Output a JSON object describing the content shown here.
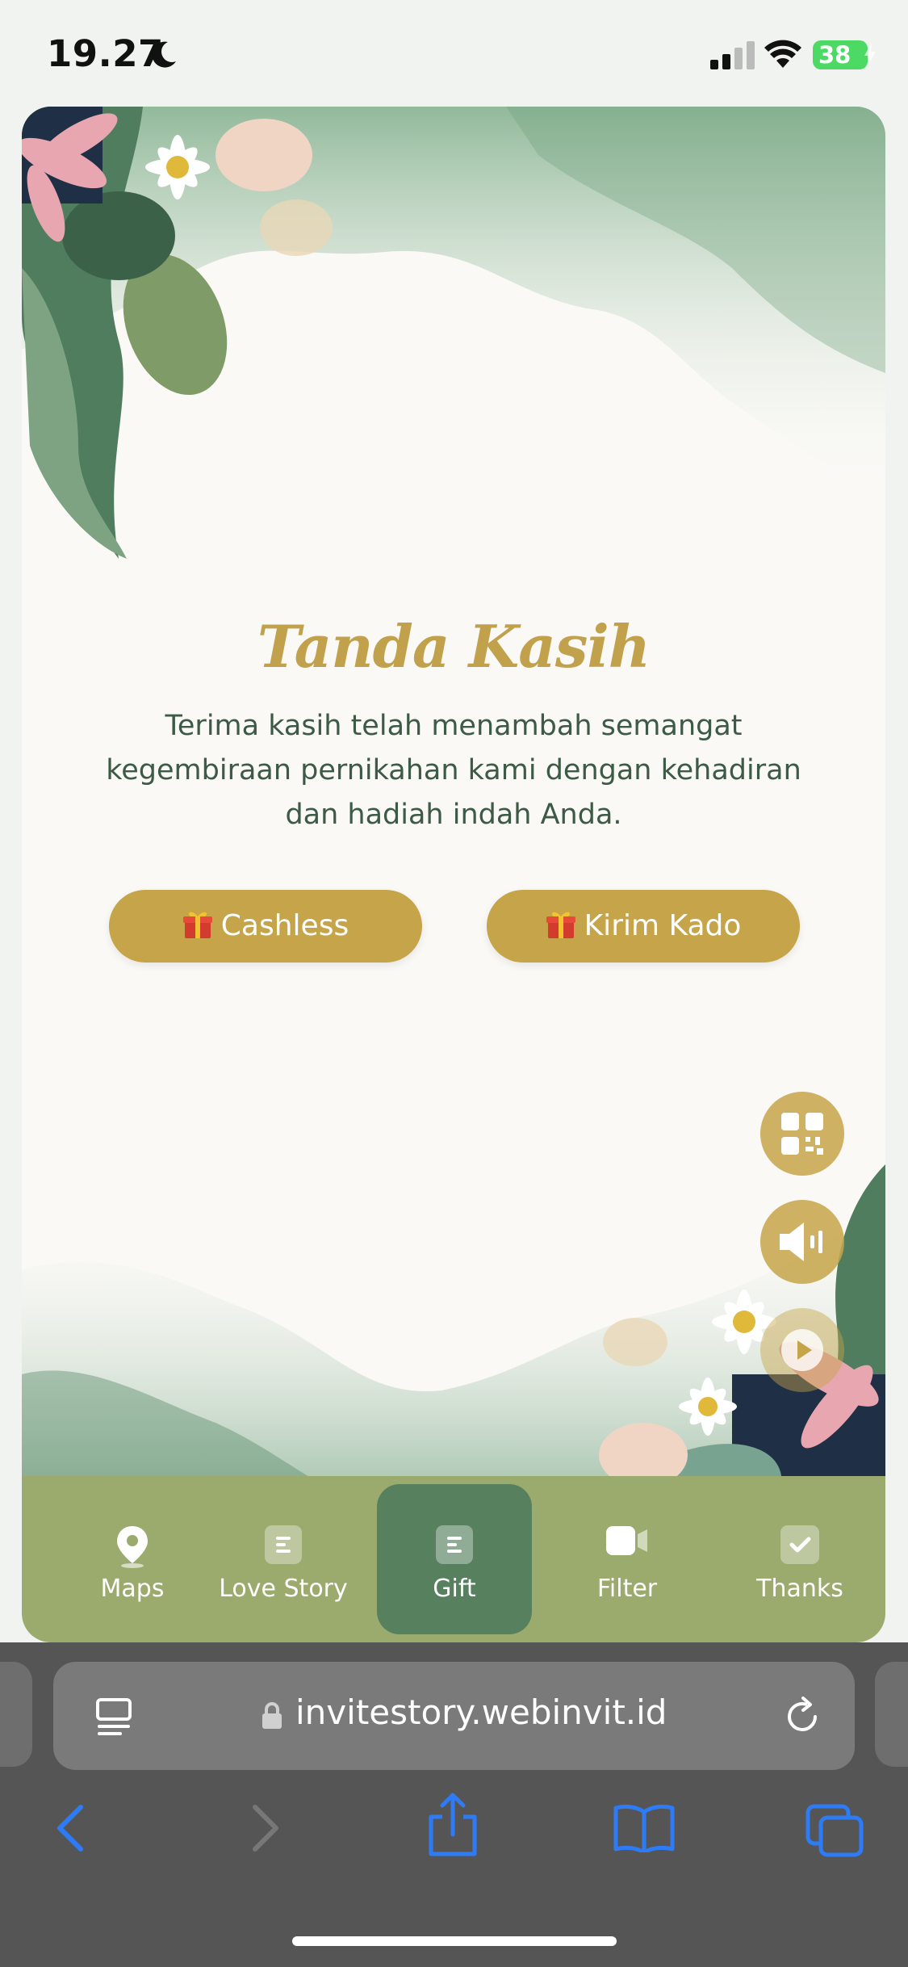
{
  "status_bar": {
    "time": "19.27",
    "battery": "38"
  },
  "gift_section": {
    "title": "Tanda Kasih",
    "message": "Terima kasih telah menambah semangat kegembiraan pernikahan kami dengan kehadiran dan hadiah indah Anda.",
    "buttons": [
      {
        "label": "Cashless",
        "icon": "gift-icon"
      },
      {
        "label": "Kirim Kado",
        "icon": "gift-icon"
      }
    ]
  },
  "floating_buttons": [
    "qr-code-icon",
    "speaker-icon",
    "play-icon"
  ],
  "nav": {
    "active": "Gift",
    "items": [
      {
        "label": "Maps",
        "icon": "map-pin-icon"
      },
      {
        "label": "Love Story",
        "icon": "document-icon"
      },
      {
        "label": "Gift",
        "icon": "document-icon"
      },
      {
        "label": "Filter",
        "icon": "video-camera-icon"
      },
      {
        "label": "Thanks",
        "icon": "checkmark-icon"
      }
    ]
  },
  "browser": {
    "url": "invitestory.webinvit.id",
    "toolbar_icons": [
      "back-icon",
      "forward-icon",
      "share-icon",
      "bookmarks-icon",
      "tabs-icon"
    ]
  },
  "colors": {
    "accent_gold": "#c6a449",
    "text_green": "#3c5a45",
    "nav_green": "#9aab6d",
    "nav_active": "#57805f",
    "browser_link_blue": "#2e7bf6"
  }
}
